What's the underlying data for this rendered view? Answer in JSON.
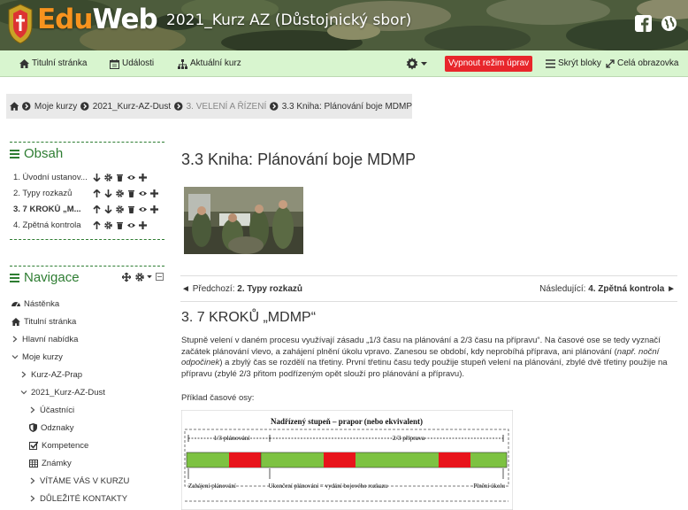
{
  "header": {
    "logo_part1": "Edu",
    "logo_part2": "Web",
    "site_title": "2021_Kurz AZ (Důstojnický sbor)"
  },
  "toolbar": {
    "home": "Titulní stránka",
    "events": "Události",
    "current_course": "Aktuální kurz",
    "edit_mode": "Vypnout režim úprav",
    "hide_blocks": "Skrýt bloky",
    "fullscreen": "Celá obrazovka"
  },
  "breadcrumb": {
    "items": [
      "Moje kurzy",
      "2021_Kurz-AZ-Dust",
      "3. VELENÍ A ŘÍZENÍ",
      "3.3 Kniha: Plánování boje MDMP"
    ]
  },
  "toc": {
    "title": "Obsah",
    "items": [
      {
        "label": "1. Úvodní ustanov..."
      },
      {
        "label": "2. Typy rozkazů"
      },
      {
        "label": "3. 7 KROKŮ „M..."
      },
      {
        "label": "4. Zpětná kontrola"
      }
    ]
  },
  "navigation": {
    "title": "Navigace",
    "items": [
      {
        "label": "Nástěnka"
      },
      {
        "label": "Titulní stránka"
      },
      {
        "label": "Hlavní nabídka"
      },
      {
        "label": "Moje kurzy"
      },
      {
        "label": "Kurz-AZ-Prap"
      },
      {
        "label": "2021_Kurz-AZ-Dust"
      },
      {
        "label": "Účastníci"
      },
      {
        "label": "Odznaky"
      },
      {
        "label": "Kompetence"
      },
      {
        "label": "Známky"
      },
      {
        "label": "VÍTÁME VÁS V KURZU"
      },
      {
        "label": "DŮLEŽITÉ KONTAKTY"
      }
    ]
  },
  "main": {
    "page_title": "3.3 Kniha: Plánování boje MDMP",
    "prev_label": "Předchozí:",
    "prev_target": "2. Typy rozkazů",
    "next_label": "Následující:",
    "next_target": "4. Zpětná kontrola",
    "section_title": "3. 7 KROKŮ „MDMP“",
    "para_1": "Stupně velení v daném procesu využívají zásadu „1/3 času na plánování a 2/3 času na přípravu“. Na časové ose se tedy vyznačí začátek plánování vlevo, a zahájení plnění úkolu vpravo. Zanesou se období, kdy neprobíhá příprava, ani plánování (",
    "para_italic": "např. noční odpočinek",
    "para_2": ") a zbylý čas se rozdělí na třetiny. První třetinu času tedy použije stupeň velení na plánování, zbylé dvě třetiny použije na přípravu (zbylé 2/3 přitom podřízeným opět slouží pro plánování a přípravu).",
    "example_label": "Příklad časové osy:",
    "timeline": {
      "title": "Nadřízený stupeň – prapor (nebo ekvivalent)",
      "label_planning": "1/3 plánování",
      "label_prep": "2/3 příprava",
      "label_start": "Zahájení plánování",
      "label_end_planning": "Ukončení plánování = vydání bojového rozkazu",
      "label_execution": "Plnění úkolu",
      "color_green": "#7dc242",
      "color_red": "#e8141b"
    }
  },
  "colors": {
    "accent_green": "#2e7d32",
    "toolbar_bg": "#d8f5cf",
    "edit_button": "#e8262b",
    "logo_orange": "#f7931e"
  }
}
